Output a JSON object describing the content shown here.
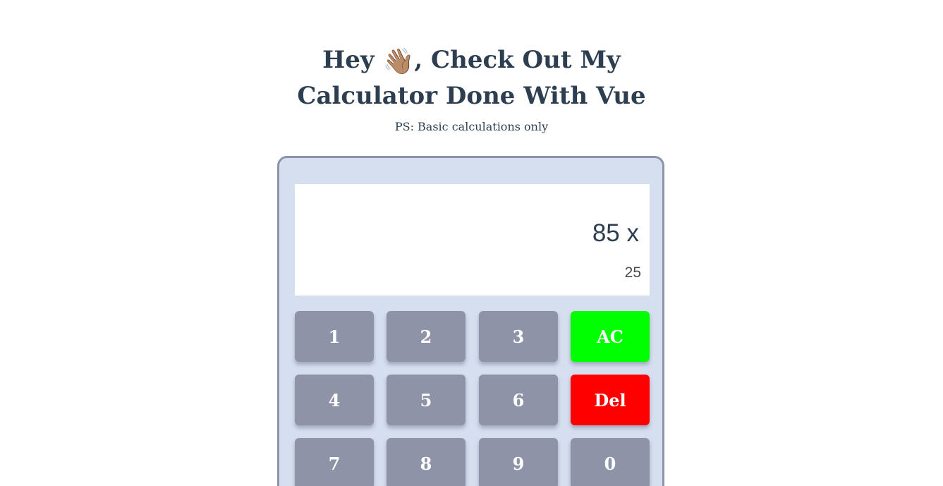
{
  "header": {
    "title_part1": "Hey",
    "title_wave": "👋🏽",
    "title_part2": ", Check Out My Calculator Done With Vue",
    "subtitle": "PS: Basic calculations only"
  },
  "display": {
    "expression": "85 x",
    "operand": "25"
  },
  "keys": {
    "k1": "1",
    "k2": "2",
    "k3": "3",
    "ac": "AC",
    "k4": "4",
    "k5": "5",
    "k6": "6",
    "del": "Del",
    "k7": "7",
    "k8": "8",
    "k9": "9",
    "k0": "0"
  },
  "colors": {
    "calculator_bg": "#d6dfef",
    "calculator_border": "#8d93aa",
    "key_bg": "#8e93a8",
    "ac_bg": "#00ff00",
    "del_bg": "#ff0000",
    "text": "#2c3e50"
  }
}
